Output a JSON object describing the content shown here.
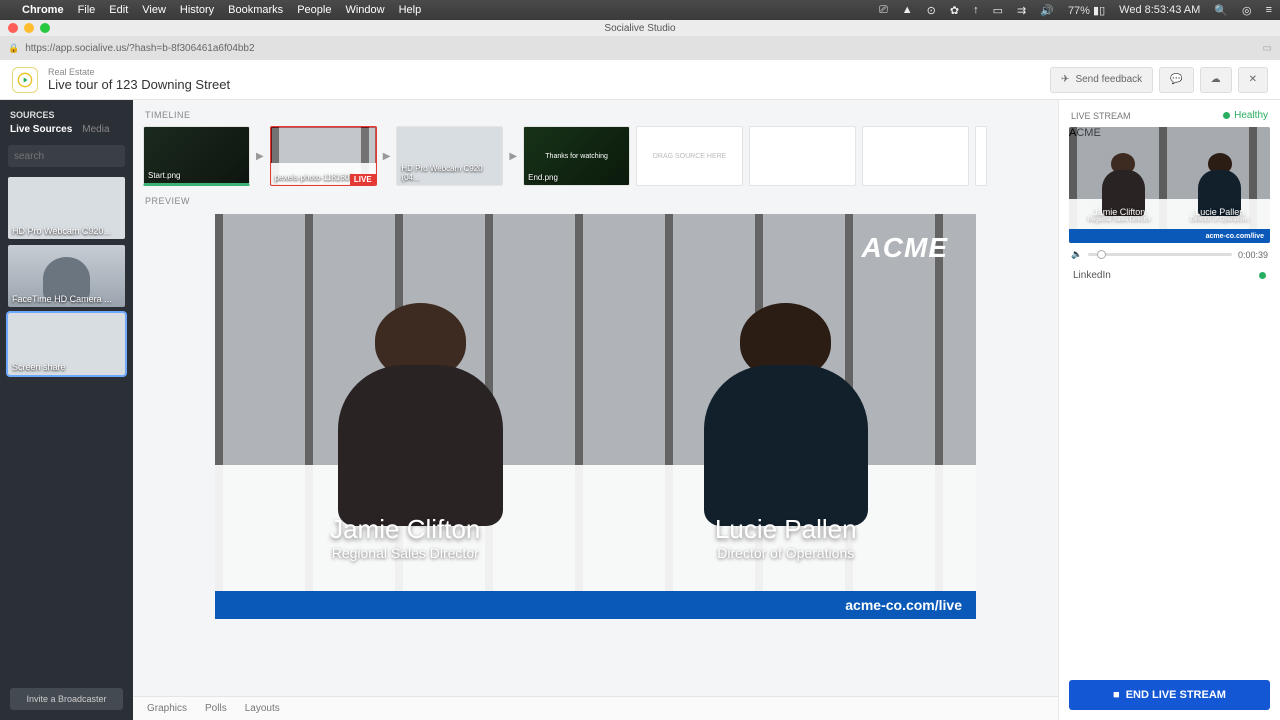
{
  "mac": {
    "app": "Chrome",
    "menus": [
      "File",
      "Edit",
      "View",
      "History",
      "Bookmarks",
      "People",
      "Window",
      "Help"
    ],
    "battery": "77%",
    "clock": "Wed 8:53:43 AM"
  },
  "window": {
    "title": "Socialive Studio"
  },
  "url": "https://app.socialive.us/?hash=b-8f306461a6f04bb2",
  "header": {
    "category": "Real Estate",
    "title": "Live tour of 123 Downing Street",
    "feedback": "Send feedback"
  },
  "sidebar": {
    "section": "SOURCES",
    "tabs": {
      "live": "Live Sources",
      "media": "Media"
    },
    "search_placeholder": "search",
    "sources": [
      {
        "label": "HD Pro Webcam C920..."
      },
      {
        "label": "FaceTime HD Camera ..."
      },
      {
        "label": "Screen share"
      }
    ],
    "invite": "Invite a Broadcaster"
  },
  "timeline": {
    "label": "TIMELINE",
    "slots": [
      {
        "caption": "Start.png",
        "kind": "start"
      },
      {
        "caption": "pexels-photo-1181605...",
        "kind": "active",
        "live": "LIVE"
      },
      {
        "caption": "HD Pro Webcam C920 (04...",
        "kind": "normal"
      },
      {
        "caption": "End.png",
        "kind": "end",
        "overlay": "Thanks for watching"
      },
      {
        "caption": "DRAG SOURCE HERE",
        "kind": "empty"
      },
      {
        "caption": "",
        "kind": "blank"
      },
      {
        "caption": "",
        "kind": "blank"
      },
      {
        "caption": "",
        "kind": "blank"
      }
    ]
  },
  "preview": {
    "label": "PREVIEW",
    "brand": "ACME",
    "url": "acme-co.com/live",
    "people": [
      {
        "name": "Jamie Clifton",
        "role": "Regional Sales Director"
      },
      {
        "name": "Lucie Pallen",
        "role": "Director of Operations"
      }
    ]
  },
  "bottom_tabs": [
    "Graphics",
    "Polls",
    "Layouts"
  ],
  "right": {
    "label": "LIVE STREAM",
    "status": "Healthy",
    "time": "0:00:39",
    "destination": "LinkedIn",
    "end": "END LIVE STREAM"
  }
}
